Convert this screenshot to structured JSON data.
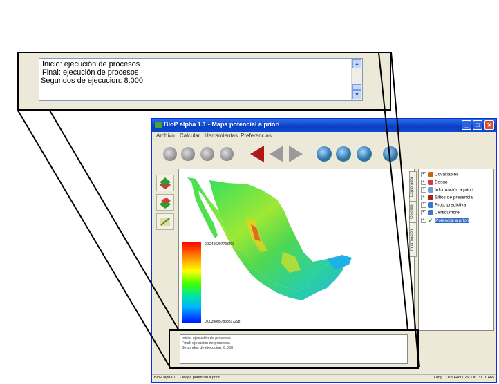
{
  "zoom": {
    "lines": [
      "Inicio: ejecución de procesos",
      " Final: ejecución de procesos",
      "Segundos de ejecucion: 8.000"
    ]
  },
  "window": {
    "title": "BioP alpha 1.1 - Mapa potencial a priori",
    "buttons": {
      "minimize": "_",
      "maximize": "□",
      "close": "✕"
    },
    "menu": [
      "Archivo",
      "Calcular",
      "Herramientas",
      "Preferencias"
    ]
  },
  "toolbar": {
    "icons": [
      "gear-icon",
      "gears-icon",
      "process-icon",
      "export-icon",
      "back-red-icon",
      "back-icon",
      "forward-icon",
      "globe-icon",
      "globe-icon",
      "globe-icon",
      "globe-icon"
    ]
  },
  "map": {
    "legend_max": "0.32456207738809",
    "legend_min": "0.00398057838817298",
    "legend_colors": [
      "#ff0000",
      "#ffa200",
      "#ffff00",
      "#3cff00",
      "#00e6a0",
      "#00b4ff",
      "#0010ff"
    ]
  },
  "side_tabs": [
    "Explorador",
    "Colores",
    "Información"
  ],
  "tree": {
    "items": [
      {
        "label": "Covariables",
        "icon": "layers-icon",
        "color": "#c86414"
      },
      {
        "label": "Sesgo",
        "icon": "bias-icon",
        "color": "#d23c3c"
      },
      {
        "label": "Información a priori",
        "icon": "info-icon",
        "color": "#6aa0d0"
      },
      {
        "label": "Sitios de presencia",
        "icon": "pin-icon",
        "color": "#b02020"
      },
      {
        "label": "Prob. predictiva",
        "icon": "chart-icon",
        "color": "#3c78c8"
      },
      {
        "label": "Certidumbre",
        "icon": "cert-icon",
        "color": "#3c78c8"
      },
      {
        "label": "Potencial a priori",
        "icon": "check-icon",
        "color": "#20a020",
        "selected": true
      }
    ]
  },
  "console": {
    "lines": [
      "Inicio: ejecución de procesos",
      "Final: ejecución de procesos",
      "Segundos de ejecucion: 8.000"
    ]
  },
  "status": {
    "left": "BioP alpha 1.1 - Mapa potencial a priori",
    "right": "Long.: -115.6480026; Lat.:31.01465"
  }
}
